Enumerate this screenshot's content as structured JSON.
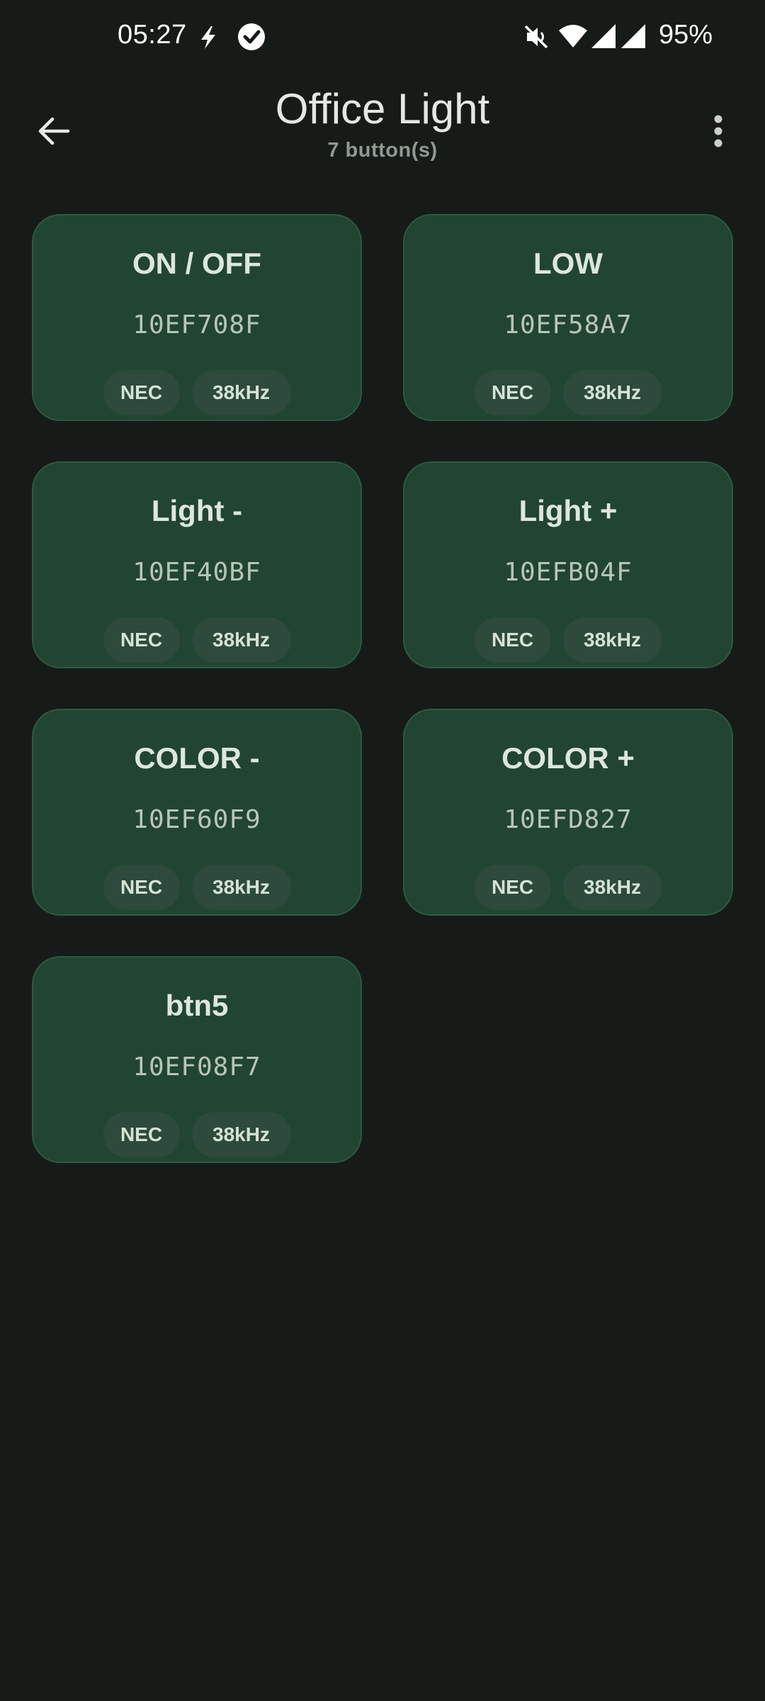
{
  "status_bar": {
    "time": "05:27",
    "battery": "95%",
    "icons": [
      "bolt-icon",
      "check-circle-icon",
      "mute-icon",
      "wifi-icon",
      "signal-icon",
      "signal-icon"
    ]
  },
  "app_bar": {
    "title": "Office Light",
    "subtitle": "7 button(s)",
    "back_icon": "arrow-left-icon",
    "menu_icon": "more-vertical-icon"
  },
  "buttons": [
    {
      "name": "ON / OFF",
      "code": "10EF708F",
      "protocol": "NEC",
      "frequency": "38kHz"
    },
    {
      "name": "LOW",
      "code": "10EF58A7",
      "protocol": "NEC",
      "frequency": "38kHz"
    },
    {
      "name": "Light -",
      "code": "10EF40BF",
      "protocol": "NEC",
      "frequency": "38kHz"
    },
    {
      "name": "Light +",
      "code": "10EFB04F",
      "protocol": "NEC",
      "frequency": "38kHz"
    },
    {
      "name": "COLOR -",
      "code": "10EF60F9",
      "protocol": "NEC",
      "frequency": "38kHz"
    },
    {
      "name": "COLOR +",
      "code": "10EFD827",
      "protocol": "NEC",
      "frequency": "38kHz"
    },
    {
      "name": "btn5",
      "code": "10EF08F7",
      "protocol": "NEC",
      "frequency": "38kHz"
    }
  ],
  "colors": {
    "background": "#171b17",
    "card": "#214532",
    "chip": "#2d4a3c"
  }
}
